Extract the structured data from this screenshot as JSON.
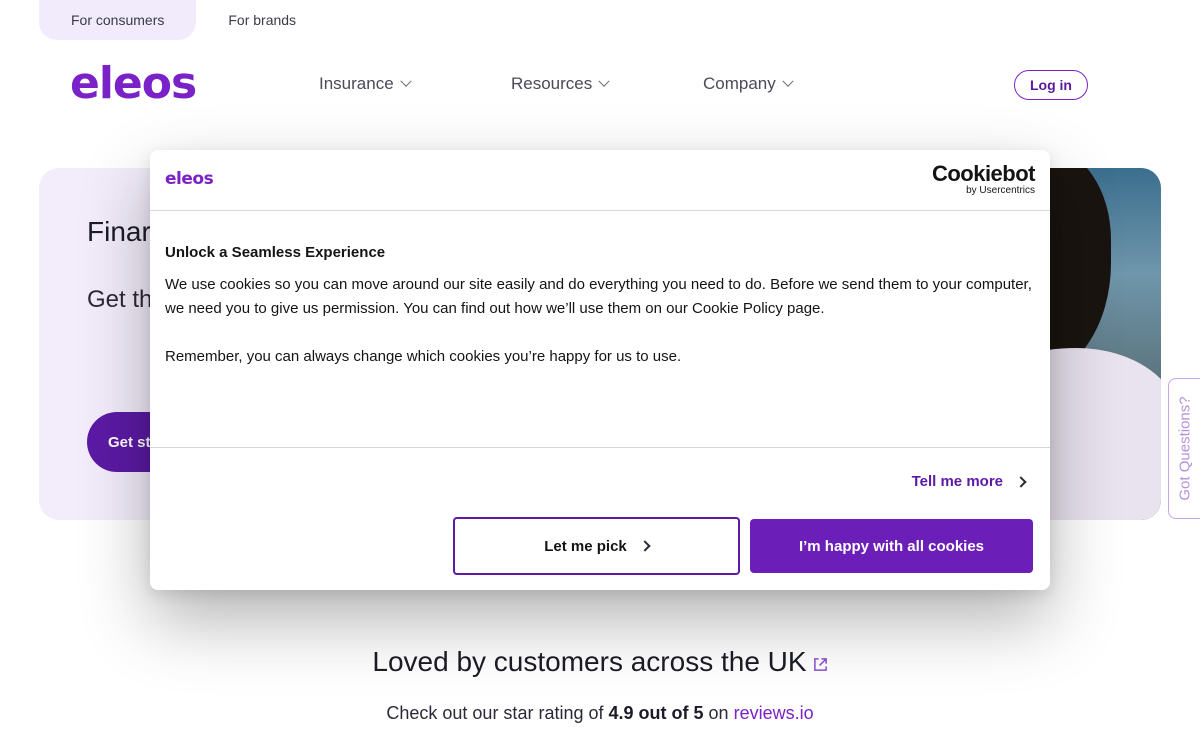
{
  "audience_tabs": [
    "For consumers",
    "For brands"
  ],
  "logo": "eleos",
  "nav": {
    "items": [
      "Insurance",
      "Resources",
      "Company"
    ],
    "login_label": "Log in"
  },
  "hero": {
    "title": "Finar",
    "subtitle": "Get th insura to a s",
    "cta_label": "Get st"
  },
  "side_tab_label": "Got Questions?",
  "cookie_dialog": {
    "logo": "eleos",
    "provider_name": "Cookiebot",
    "provider_by": "by Usercentrics",
    "title": "Unlock a Seamless Experience",
    "text1": "We use cookies so you can move around our site easily and do everything you need to do. Before we send them to your computer, we need you to give us permission. You can find out how we’ll use them on our Cookie Policy page.",
    "text2": "Remember, you can always change which cookies you’re happy for us to use.",
    "tell_more_label": "Tell me more",
    "pick_label": "Let me pick",
    "accept_label": "I’m happy with all cookies"
  },
  "reviews": {
    "heading": "Loved by customers across the UK",
    "prefix": "Check out our star rating of",
    "rating": "4.9 out of 5",
    "middle": "on",
    "link": "reviews.io"
  },
  "colors": {
    "brand_purple": "#7a22c7",
    "button_purple": "#6b1fb8",
    "hero_bg": "#f3edfb"
  }
}
